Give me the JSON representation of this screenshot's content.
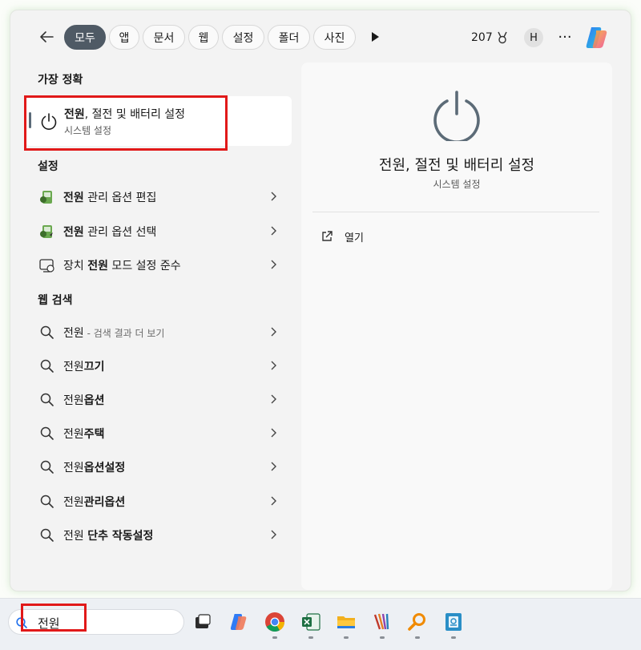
{
  "filter_bar": {
    "tabs": [
      {
        "label": "모두",
        "active": true
      },
      {
        "label": "앱",
        "active": false
      },
      {
        "label": "문서",
        "active": false
      },
      {
        "label": "웹",
        "active": false
      },
      {
        "label": "설정",
        "active": false
      },
      {
        "label": "폴더",
        "active": false
      },
      {
        "label": "사진",
        "active": false
      }
    ],
    "points": "207",
    "avatar_initial": "H",
    "more_label": "···"
  },
  "results": {
    "best_match_heading": "가장 정확",
    "best_match": {
      "title_bold": "전원",
      "title_rest": ", 절전 및 배터리 설정",
      "subtitle": "시스템 설정"
    },
    "settings_heading": "설정",
    "settings_items": [
      {
        "icon": "power-options-icon",
        "bold": "전원",
        "rest": " 관리 옵션 편집"
      },
      {
        "icon": "power-options-icon",
        "bold": "전원",
        "rest": " 관리 옵션 선택"
      },
      {
        "icon": "device-power-mode-icon",
        "prefix": "장치 ",
        "bold": "전원",
        "rest": " 모드 설정 준수"
      }
    ],
    "web_heading": "웹 검색",
    "web_items": [
      {
        "text": "전원",
        "suffix": " - 검색 결과 더 보기"
      },
      {
        "text": "전원",
        "bold": "끄기"
      },
      {
        "text": "전원",
        "bold": "옵션"
      },
      {
        "text": "전원",
        "bold": "주택"
      },
      {
        "text": "전원",
        "bold": "옵션설정"
      },
      {
        "text": "전원",
        "bold": "관리옵션"
      },
      {
        "text": "전원 ",
        "bold": "단추 작동설정"
      }
    ]
  },
  "detail": {
    "title": "전원, 절전 및 배터리 설정",
    "subtitle": "시스템 설정",
    "open_label": "열기"
  },
  "taskbar": {
    "search_value": "전원",
    "apps": [
      "task-view-icon",
      "copilot-icon",
      "chrome-icon",
      "excel-icon",
      "file-explorer-icon",
      "winrar-icon",
      "search-magnifier-app-icon",
      "hangul-app-icon"
    ]
  },
  "colors": {
    "active_chip": "#4f5a65",
    "highlight_red": "#e11919",
    "panel_bg": "#f3f3f3",
    "detail_bg": "#f9f9f9"
  }
}
